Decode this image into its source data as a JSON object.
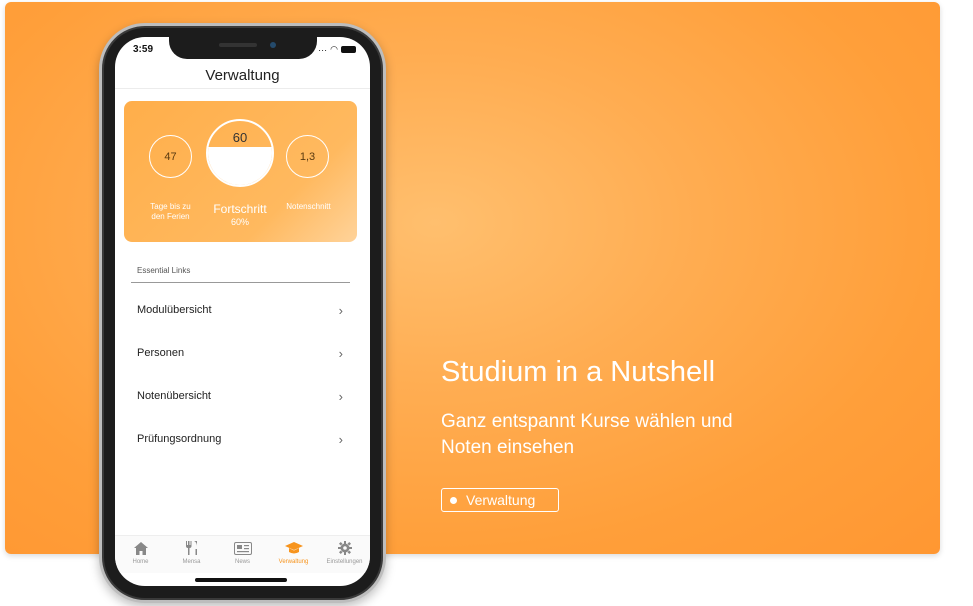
{
  "banner": {
    "title": "Studium in a Nutshell",
    "subtitle": "Ganz entspannt Kurse wählen und Noten einsehen",
    "button_label": "Verwaltung"
  },
  "phone": {
    "status_time": "3:59",
    "app_title": "Verwaltung",
    "stats": {
      "days_value": "47",
      "days_label_line1": "Tage bis zu",
      "days_label_line2": "den Ferien",
      "progress_value": "60",
      "progress_fraction": 0.6,
      "progress_label": "Fortschritt",
      "progress_percent": "60%",
      "grade_value": "1,3",
      "grade_label": "Notenschnitt"
    },
    "links_header": "Essential Links",
    "links": [
      {
        "label": "Modulübersicht"
      },
      {
        "label": "Personen"
      },
      {
        "label": "Notenübersicht"
      },
      {
        "label": "Prüfungsordnung"
      }
    ],
    "tabs": [
      {
        "label": "Home",
        "icon": "home-icon"
      },
      {
        "label": "Mensa",
        "icon": "cutlery-icon"
      },
      {
        "label": "News",
        "icon": "newspaper-icon"
      },
      {
        "label": "Verwaltung",
        "icon": "graduation-cap-icon",
        "active": true
      },
      {
        "label": "Einstellungen",
        "icon": "gear-icon"
      }
    ]
  },
  "colors": {
    "accent": "#f7941d",
    "banner": "#ff9f3a"
  }
}
